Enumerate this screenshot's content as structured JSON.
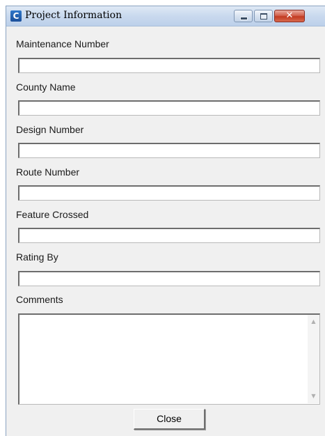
{
  "window": {
    "title": "Project Information",
    "icon": "app-c-icon",
    "controls": {
      "minimize_icon": "minimize-icon",
      "maximize_icon": "maximize-icon",
      "close_glyph": "✕"
    }
  },
  "fields": {
    "maintenance_number": {
      "label": "Maintenance Number",
      "value": ""
    },
    "county_name": {
      "label": "County Name",
      "value": ""
    },
    "design_number": {
      "label": "Design Number",
      "value": ""
    },
    "route_number": {
      "label": "Route Number",
      "value": ""
    },
    "feature_crossed": {
      "label": "Feature Crossed",
      "value": ""
    },
    "rating_by": {
      "label": "Rating By",
      "value": ""
    },
    "comments": {
      "label": "Comments",
      "value": ""
    }
  },
  "buttons": {
    "close_label": "Close"
  },
  "colors": {
    "titlebar": "#c9d9ee",
    "window_bg": "#f0f0f0",
    "close_button_red": "#c23a22"
  }
}
